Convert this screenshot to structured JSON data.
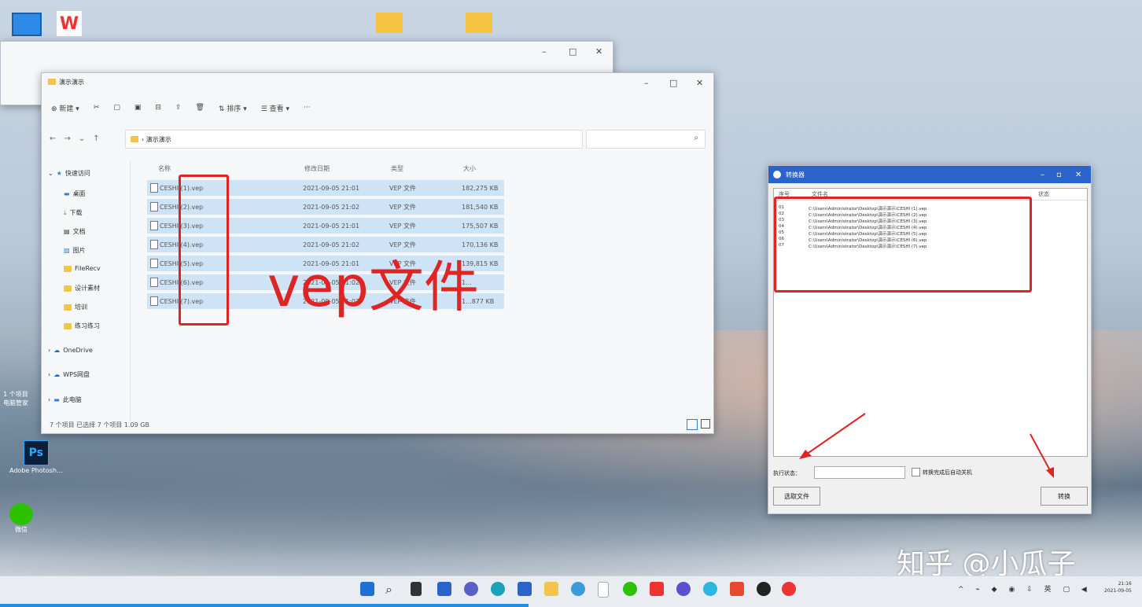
{
  "explorer": {
    "title": "演示演示",
    "toolbar": {
      "new": "新建",
      "sort": "排序",
      "view": "查看",
      "more": "···"
    },
    "address": "› 演示演示",
    "columns": [
      "名称",
      "修改日期",
      "类型",
      "大小"
    ],
    "files": [
      {
        "name": "CESHI (1).vep",
        "date": "2021-09-05 21:01",
        "type": "VEP 文件",
        "size": "182,275 KB"
      },
      {
        "name": "CESHI (2).vep",
        "date": "2021-09-05 21:02",
        "type": "VEP 文件",
        "size": "181,540 KB"
      },
      {
        "name": "CESHI (3).vep",
        "date": "2021-09-05 21:01",
        "type": "VEP 文件",
        "size": "175,507 KB"
      },
      {
        "name": "CESHI (4).vep",
        "date": "2021-09-05 21:02",
        "type": "VEP 文件",
        "size": "170,136 KB"
      },
      {
        "name": "CESHI (5).vep",
        "date": "2021-09-05 21:01",
        "type": "VEP 文件",
        "size": "139,815 KB"
      },
      {
        "name": "CESHI (6).vep",
        "date": "2021-09-05 21:02",
        "type": "VEP 文件",
        "size": "1..."
      },
      {
        "name": "CESHI (7).vep",
        "date": "2021-09-05 21:02",
        "type": "VEP 文件",
        "size": "1...877 KB"
      }
    ],
    "sidebar": [
      "快速访问",
      "桌面",
      "下载",
      "文档",
      "图片",
      "FileRecv",
      "设计素材",
      "培训",
      "练习练习",
      "OneDrive",
      "WPS网盘",
      "此电脑"
    ],
    "status": "7 个项目   已选择 7 个项目  1.09 GB"
  },
  "annotation": "vep文件",
  "converter": {
    "title": "转换器",
    "columns": [
      "序号",
      "文件名",
      "状态"
    ],
    "rows": [
      {
        "no": "01",
        "path": "C:\\Users\\Administrator\\Desktop\\演示演示\\CESHI (1).vep"
      },
      {
        "no": "02",
        "path": "C:\\Users\\Administrator\\Desktop\\演示演示\\CESHI (2).vep"
      },
      {
        "no": "03",
        "path": "C:\\Users\\Administrator\\Desktop\\演示演示\\CESHI (3).vep"
      },
      {
        "no": "04",
        "path": "C:\\Users\\Administrator\\Desktop\\演示演示\\CESHI (4).vep"
      },
      {
        "no": "05",
        "path": "C:\\Users\\Administrator\\Desktop\\演示演示\\CESHI (5).vep"
      },
      {
        "no": "06",
        "path": "C:\\Users\\Administrator\\Desktop\\演示演示\\CESHI (6).vep"
      },
      {
        "no": "07",
        "path": "C:\\Users\\Administrator\\Desktop\\演示演示\\CESHI (7).vep"
      }
    ],
    "status_label": "执行状态：",
    "checkbox_label": "转换完成后自动关机",
    "select_button": "选取文件",
    "convert_button": "转换"
  },
  "desktop": {
    "ps_label": "Adobe Photosh...",
    "wechat_label": "微信",
    "pc_label": "电脑管家",
    "items_count": "1 个项目"
  },
  "watermark": "知乎 @小瓜子",
  "tray": {
    "time": "21:16",
    "date": "2021-09-05"
  }
}
